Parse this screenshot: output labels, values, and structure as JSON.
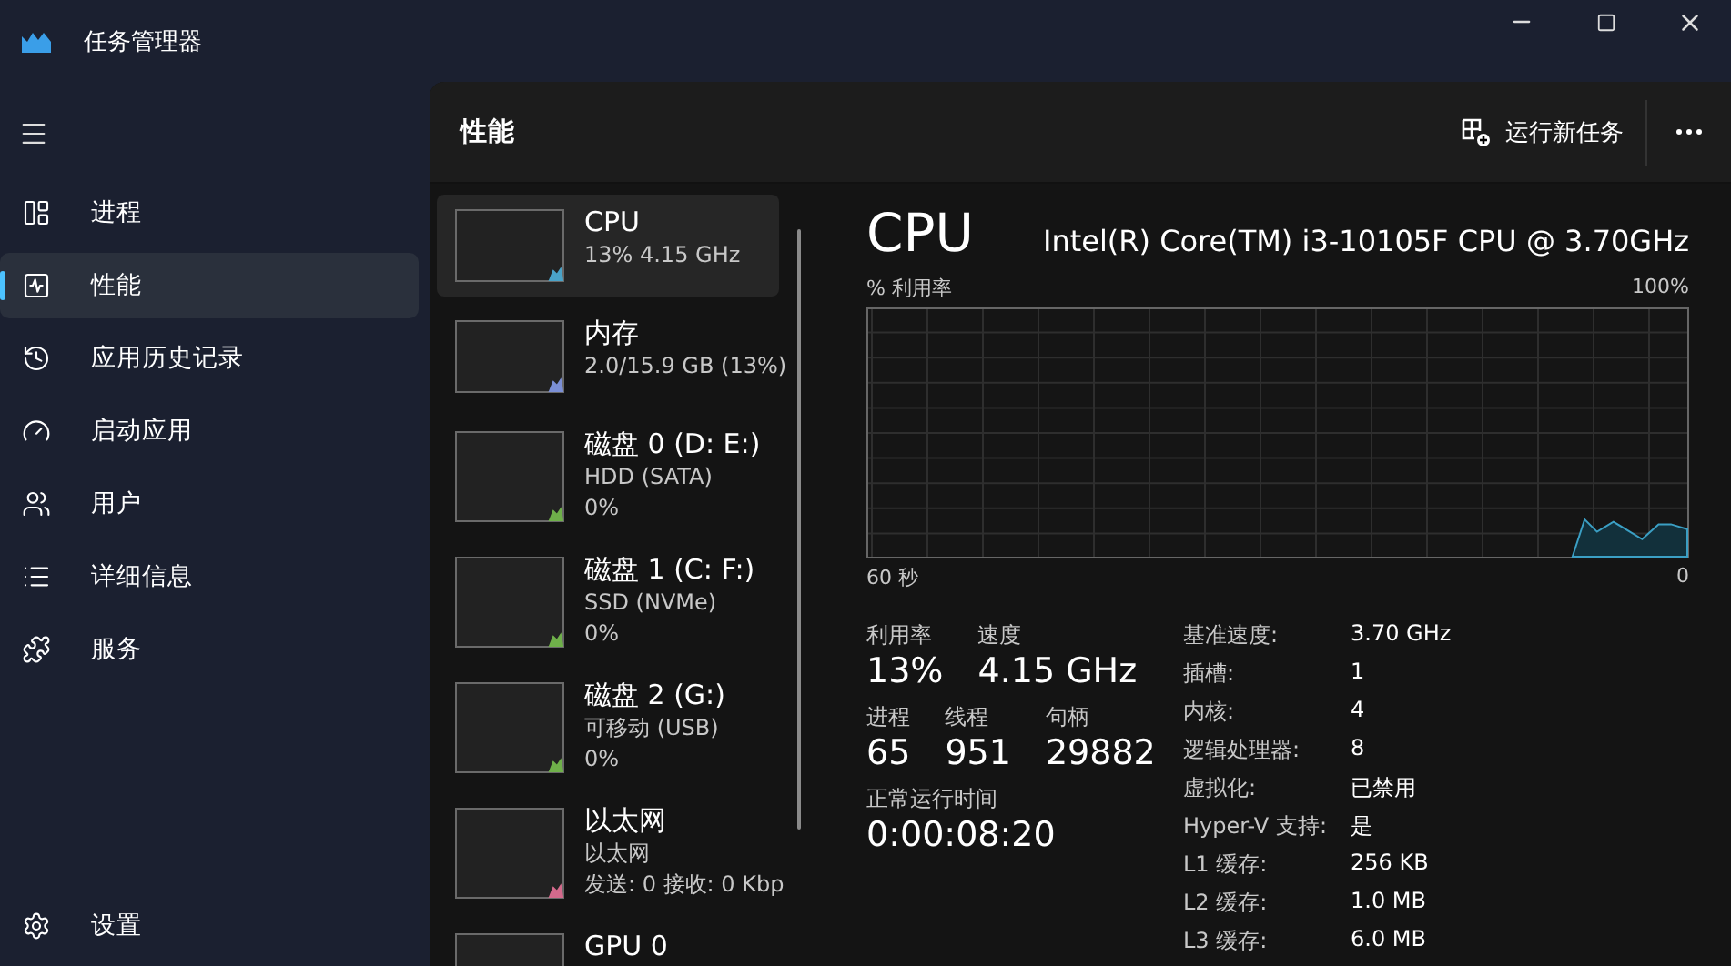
{
  "window": {
    "title": "任务管理器"
  },
  "sidebar": {
    "items": [
      {
        "kind": "processes",
        "label": "进程",
        "selected": false
      },
      {
        "kind": "performance",
        "label": "性能",
        "selected": true
      },
      {
        "kind": "history",
        "label": "应用历史记录",
        "selected": false
      },
      {
        "kind": "startup",
        "label": "启动应用",
        "selected": false
      },
      {
        "kind": "users",
        "label": "用户",
        "selected": false
      },
      {
        "kind": "details",
        "label": "详细信息",
        "selected": false
      },
      {
        "kind": "services",
        "label": "服务",
        "selected": false
      }
    ],
    "settings": "设置"
  },
  "header": {
    "title": "性能",
    "run_task": "运行新任务"
  },
  "devices": [
    {
      "name": "CPU",
      "lines": [
        "13% 4.15 GHz"
      ],
      "color": "#4aa3c8",
      "selected": true
    },
    {
      "name": "内存",
      "lines": [
        "2.0/15.9 GB (13%)"
      ],
      "color": "#7b8fd6",
      "selected": false
    },
    {
      "name": "磁盘 0 (D: E:)",
      "lines": [
        "HDD (SATA)",
        "0%"
      ],
      "color": "#6fb04a",
      "selected": false
    },
    {
      "name": "磁盘 1 (C: F:)",
      "lines": [
        "SSD (NVMe)",
        "0%"
      ],
      "color": "#6fb04a",
      "selected": false
    },
    {
      "name": "磁盘 2 (G:)",
      "lines": [
        "可移动 (USB)",
        "0%"
      ],
      "color": "#6fb04a",
      "selected": false
    },
    {
      "name": "以太网",
      "lines": [
        "以太网",
        "发送: 0 接收: 0 Kbp"
      ],
      "color": "#d46a8c",
      "selected": false
    },
    {
      "name": "GPU 0",
      "selected": false
    }
  ],
  "detail": {
    "title": "CPU",
    "model": "Intel(R) Core(TM) i3-10105F CPU @ 3.70GHz",
    "graph": {
      "ylabel": "% 利用率",
      "ymax": "100%",
      "xstart": "60 秒",
      "xend": "0"
    },
    "stat_rows": [
      [
        {
          "label": "利用率",
          "value": "13%"
        },
        {
          "label": "速度",
          "value": "4.15 GHz"
        }
      ],
      [
        {
          "label": "进程",
          "value": "65"
        },
        {
          "label": "线程",
          "value": "951"
        },
        {
          "label": "句柄",
          "value": "29882"
        }
      ],
      [
        {
          "label": "正常运行时间",
          "value": "0:00:08:20"
        }
      ]
    ],
    "properties": [
      {
        "label": "基准速度:",
        "value": "3.70 GHz"
      },
      {
        "label": "插槽:",
        "value": "1"
      },
      {
        "label": "内核:",
        "value": "4"
      },
      {
        "label": "逻辑处理器:",
        "value": "8"
      },
      {
        "label": "虚拟化:",
        "value": "已禁用"
      },
      {
        "label": "Hyper-V 支持:",
        "value": "是"
      },
      {
        "label": "L1 缓存:",
        "value": "256 KB"
      },
      {
        "label": "L2 缓存:",
        "value": "1.0 MB"
      },
      {
        "label": "L3 缓存:",
        "value": "6.0 MB"
      }
    ]
  }
}
